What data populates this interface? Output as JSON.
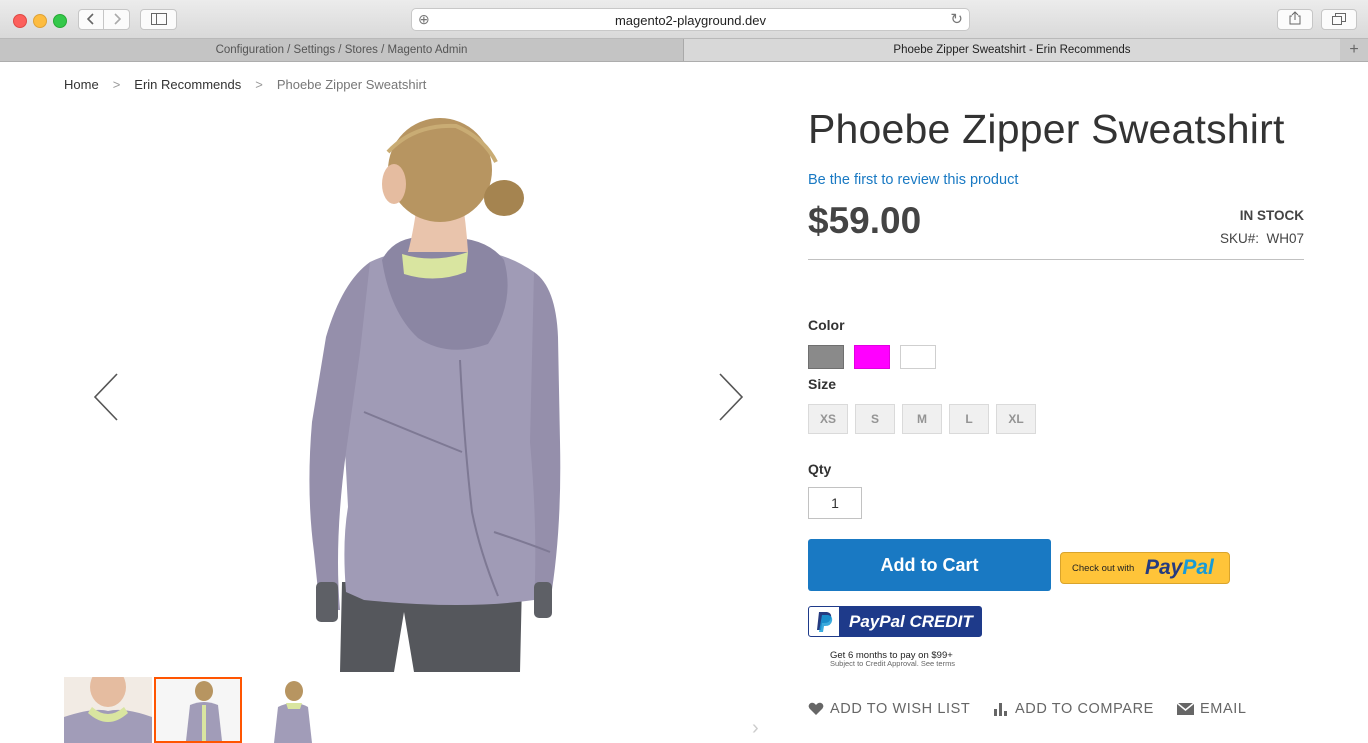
{
  "browser": {
    "url": "magento2-playground.dev",
    "tabs": [
      {
        "label": "Configuration / Settings / Stores / Magento Admin",
        "active": false
      },
      {
        "label": "Phoebe Zipper Sweatshirt - Erin Recommends",
        "active": true
      }
    ],
    "new_tab": "+"
  },
  "breadcrumb": {
    "items": [
      "Home",
      "Erin Recommends",
      "Phoebe Zipper Sweatshirt"
    ],
    "separator": ">"
  },
  "gallery": {
    "prev_glyph": "〈",
    "next_glyph": "〉",
    "selected_thumbnail": 2
  },
  "product": {
    "title": "Phoebe Zipper Sweatshirt",
    "review_link": "Be the first to review this product",
    "price": "$59.00",
    "stock": "IN STOCK",
    "sku_label": "SKU#:",
    "sku": "WH07",
    "color_label": "Color",
    "colors": [
      "#8a8a8a",
      "#ff00ff",
      "#ffffff"
    ],
    "size_label": "Size",
    "sizes": [
      "XS",
      "S",
      "M",
      "L",
      "XL"
    ],
    "qty_label": "Qty",
    "qty": "1",
    "add_to_cart": "Add to Cart",
    "paypal_checkout_small": "Check out with",
    "paypal_word_1": "Pay",
    "paypal_word_2": "Pal",
    "paypal_credit": "PayPal CREDIT",
    "credit_note": "Get 6 months to pay on $99+",
    "credit_subnote": "Subject to Credit Approval. See terms",
    "actions": {
      "wishlist": "ADD TO WISH LIST",
      "compare": "ADD TO COMPARE",
      "email": "EMAIL"
    }
  },
  "colors": {
    "accent": "#1979c3",
    "paypal_yellow": "#ffc439",
    "paypal_credit_blue": "#1e3a8a",
    "selected_thumb_border": "#ff5501"
  }
}
